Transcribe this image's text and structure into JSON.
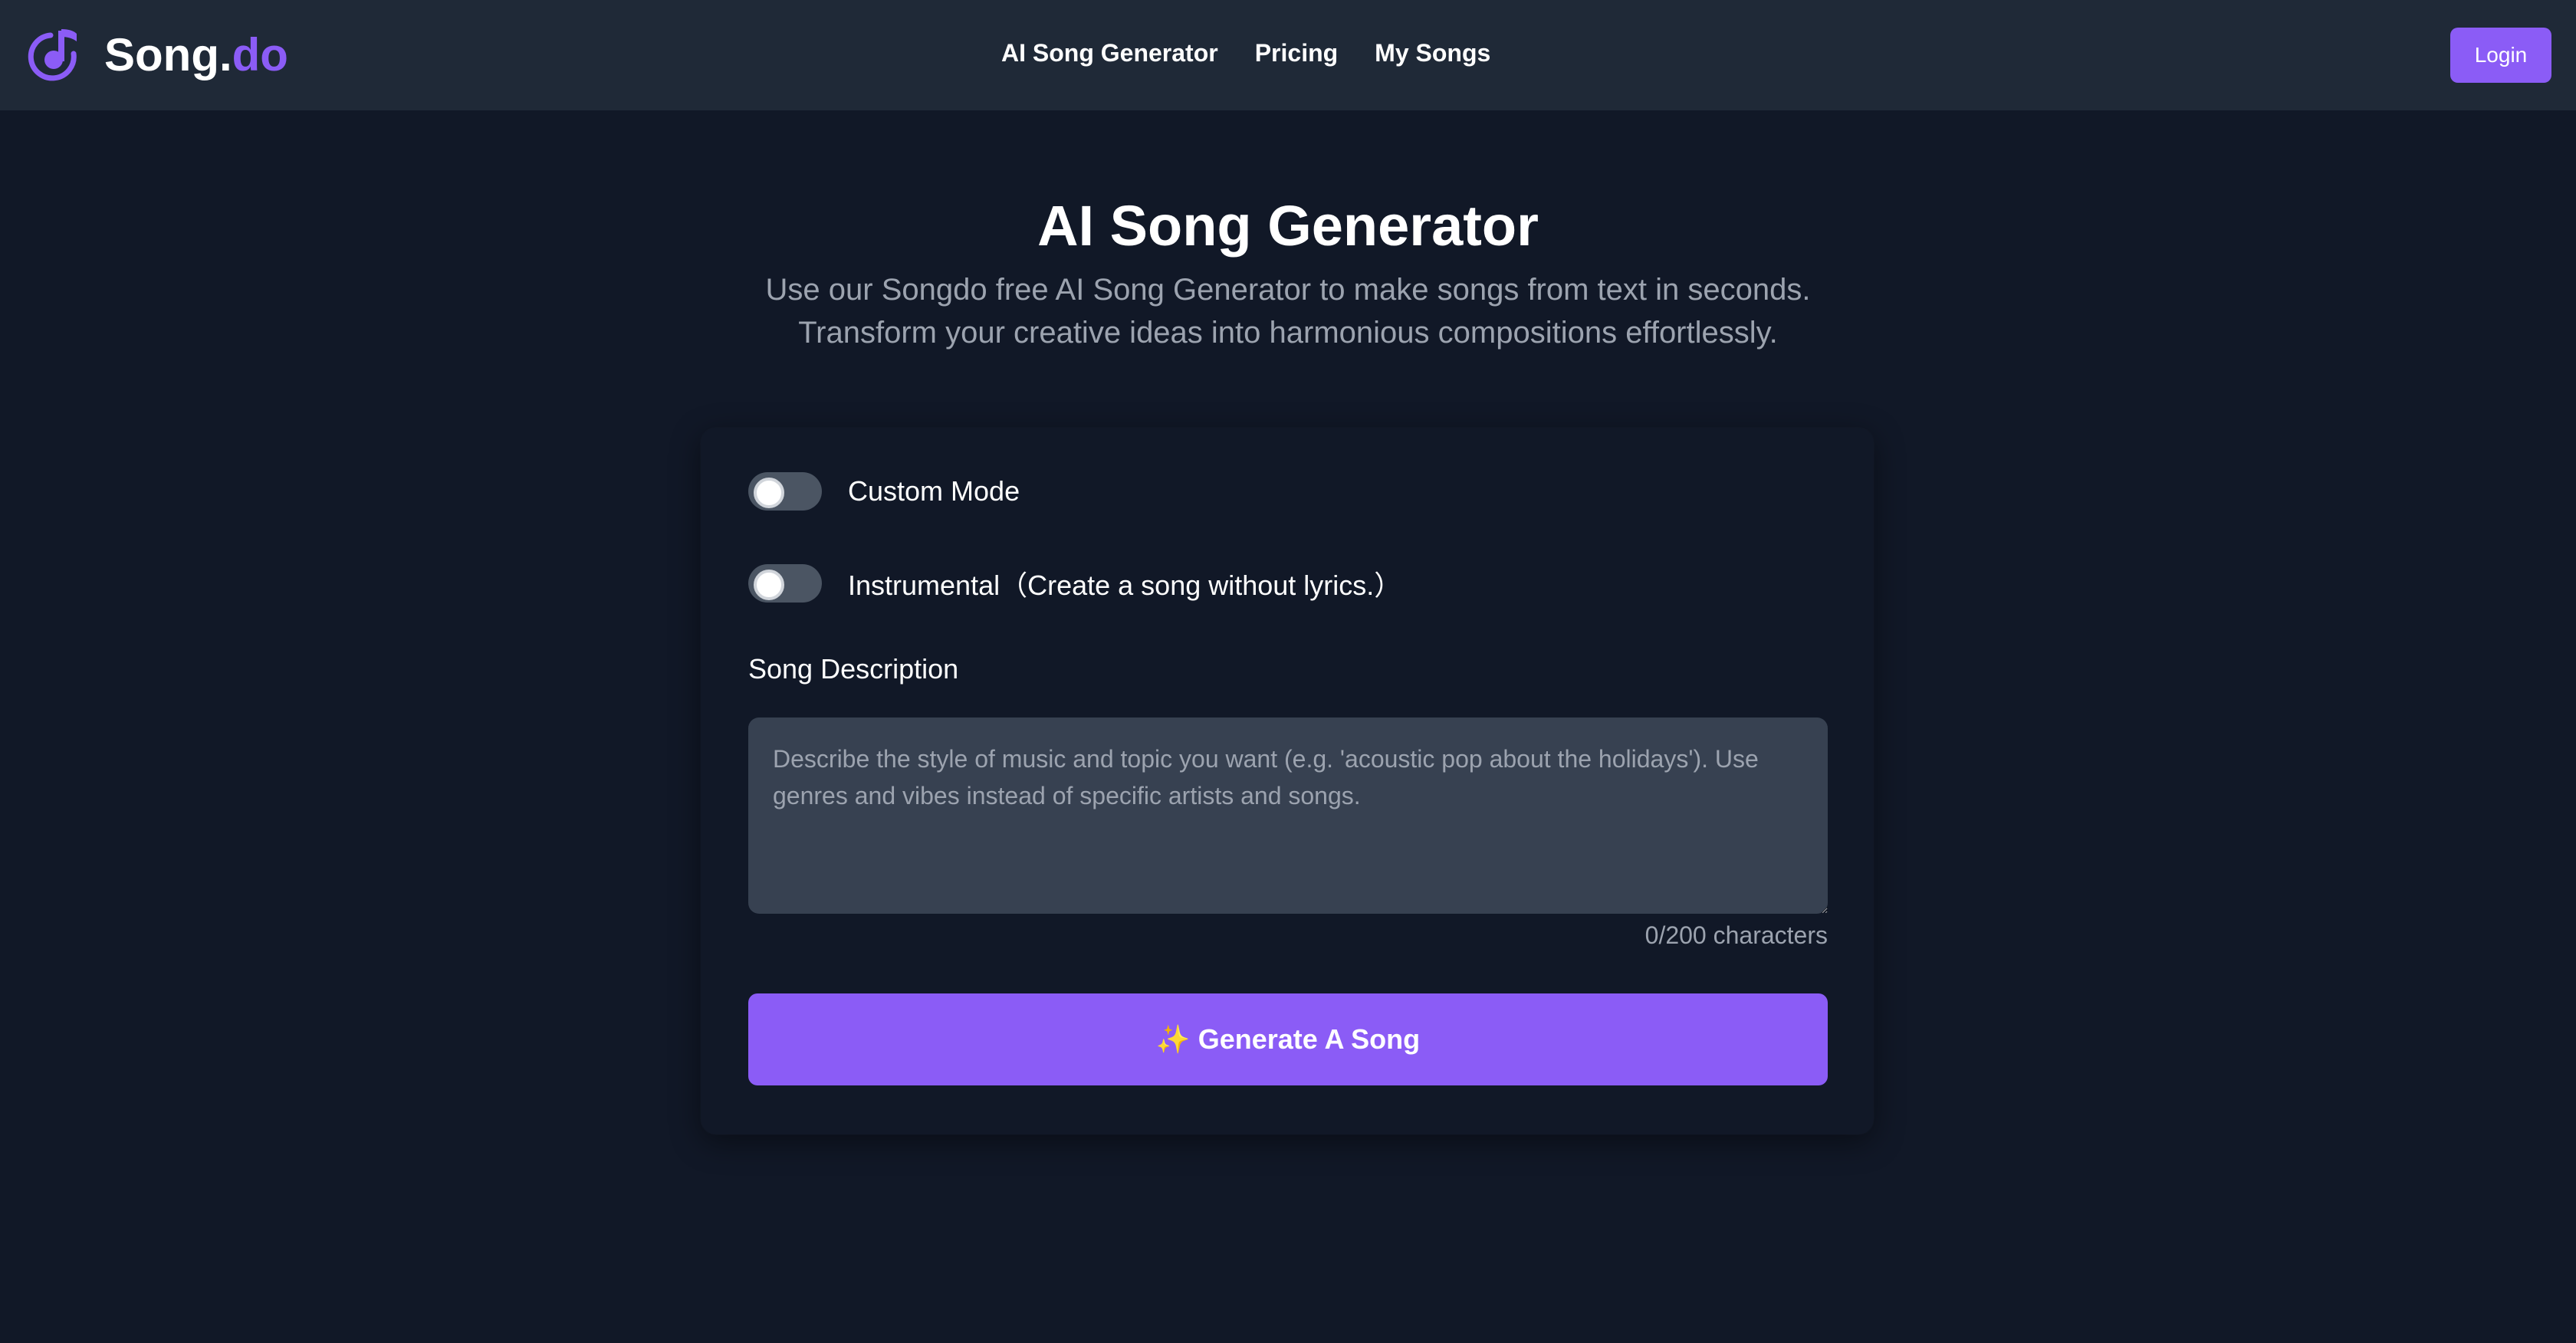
{
  "brand": {
    "name": "Song.",
    "name_accent": "do",
    "logo_icon": "music-note-icon",
    "accent_color": "#8b5cf6"
  },
  "nav": {
    "items": [
      {
        "label": "AI Song Generator"
      },
      {
        "label": "Pricing"
      },
      {
        "label": "My Songs"
      }
    ]
  },
  "header": {
    "login_label": "Login"
  },
  "hero": {
    "title": "AI Song Generator",
    "subtitle_line1": "Use our Songdo free AI Song Generator to make songs from text in seconds.",
    "subtitle_line2": "Transform your creative ideas into harmonious compositions effortlessly."
  },
  "form": {
    "custom_mode": {
      "label": "Custom Mode",
      "enabled": false
    },
    "instrumental": {
      "label": "Instrumental（Create a song without lyrics.）",
      "enabled": false
    },
    "description": {
      "label": "Song Description",
      "value": "",
      "placeholder": "Describe the style of music and topic you want (e.g. 'acoustic pop about the holidays'). Use genres and vibes instead of specific artists and songs.",
      "char_count": "0/200 characters"
    },
    "generate": {
      "icon": "sparkles-icon",
      "icon_glyph": "✨",
      "label": "Generate A Song"
    }
  },
  "colors": {
    "background": "#111827",
    "header_bg": "#1f2937",
    "input_bg": "#374151",
    "toggle_off": "#4b5563",
    "muted_text": "#9ca3af",
    "primary": "#8b5cf6"
  }
}
